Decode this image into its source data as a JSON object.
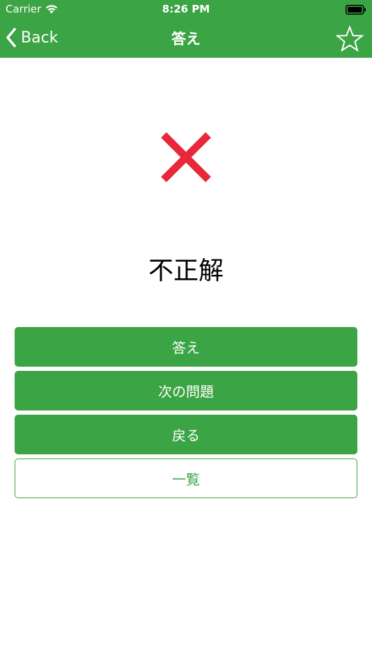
{
  "status_bar": {
    "carrier": "Carrier",
    "time": "8:26 PM",
    "wifi_icon": "wifi-icon",
    "battery_icon": "battery-icon"
  },
  "nav_bar": {
    "back_label": "Back",
    "title": "答え",
    "back_icon": "chevron-left-icon",
    "favorite_icon": "star-outline-icon"
  },
  "result": {
    "icon": "cross-icon",
    "text": "不正解"
  },
  "buttons": [
    {
      "label": "答え",
      "style": "solid"
    },
    {
      "label": "次の問題",
      "style": "solid"
    },
    {
      "label": "戻る",
      "style": "solid"
    },
    {
      "label": "一覧",
      "style": "outline"
    }
  ],
  "colors": {
    "accent": "#3ba444",
    "incorrect": "#e8283a",
    "text": "#000000",
    "background": "#ffffff"
  }
}
